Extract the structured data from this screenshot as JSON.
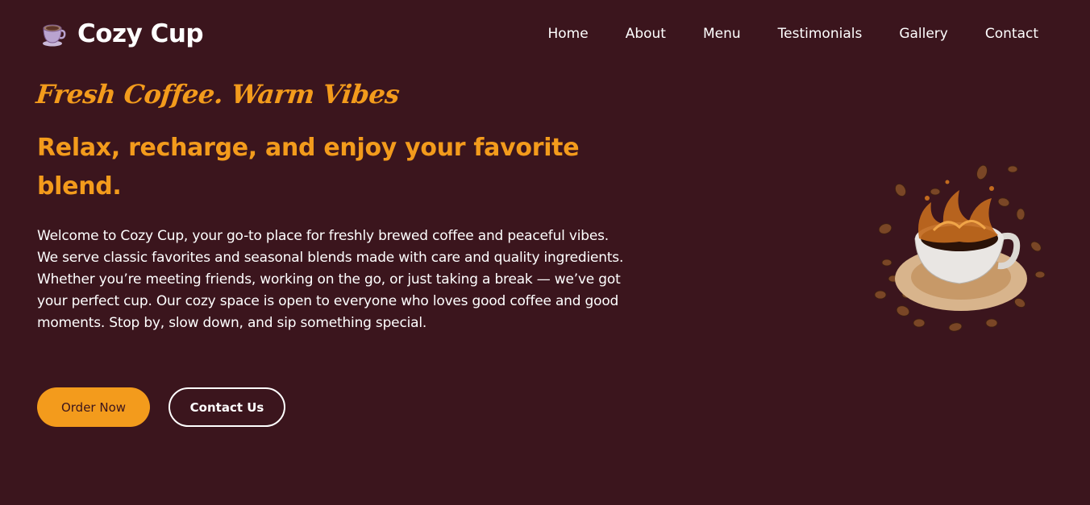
{
  "brand": {
    "name": "Cozy Cup",
    "icon": "coffee-cup-icon"
  },
  "nav": {
    "items": [
      {
        "label": "Home"
      },
      {
        "label": "About"
      },
      {
        "label": "Menu"
      },
      {
        "label": "Testimonials"
      },
      {
        "label": "Gallery"
      },
      {
        "label": "Contact"
      }
    ]
  },
  "hero": {
    "tagline": "Fresh Coffee. Warm Vibes",
    "headline": "Relax, recharge, and enjoy your favorite blend.",
    "description": "Welcome to Cozy Cup, your go-to place for freshly brewed coffee and peaceful vibes. We serve classic favorites and seasonal blends made with care and quality ingredients. Whether you’re meeting friends, working on the go, or just taking a break — we’ve got your perfect cup. Our cozy space is open to everyone who loves good coffee and good moments. Stop by, slow down, and sip something special.",
    "order_button": "Order Now",
    "contact_button": "Contact Us",
    "image": "coffee-splash-cup-image"
  },
  "colors": {
    "background": "#3b151d",
    "accent": "#f39b1c",
    "text": "#ffffff"
  }
}
